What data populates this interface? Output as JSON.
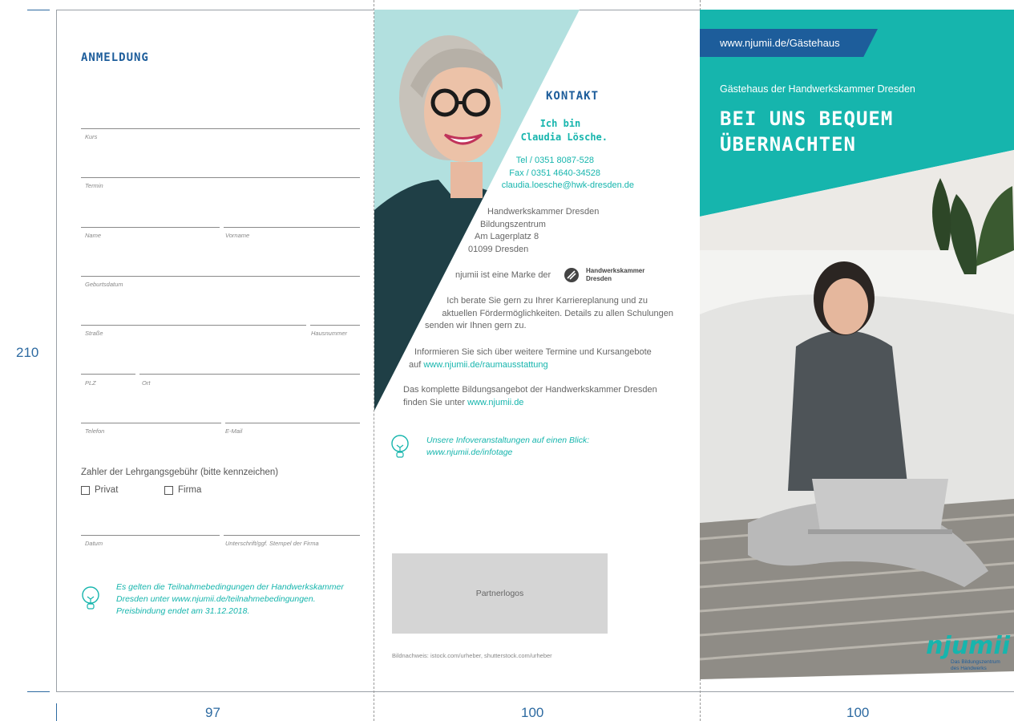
{
  "dimensions": {
    "height_label": "210",
    "panel_widths": [
      "97",
      "100",
      "100"
    ]
  },
  "colors": {
    "teal": "#16b5ad",
    "blue": "#1d5d9b",
    "light_teal": "#b2e0df"
  },
  "left_panel": {
    "title": "ANMELDUNG",
    "fields": {
      "kurs": "Kurs",
      "termin": "Termin",
      "name": "Name",
      "vorname": "Vorname",
      "geburtsdatum": "Geburtsdatum",
      "strasse": "Straße",
      "hausnummer": "Hausnummer",
      "plz": "PLZ",
      "ort": "Ort",
      "telefon": "Telefon",
      "email": "E-Mail",
      "datum": "Datum",
      "unterschrift": "Unterschrift/ggf. Stempel der Firma"
    },
    "payer_label": "Zahler der Lehrgangsgebühr (bitte kennzeichen)",
    "option_private": "Privat",
    "option_company": "Firma",
    "note_lines": [
      "Es gelten die Teilnahmebedingungen der Handwerkskammer",
      "Dresden unter www.njumii.de/teilnahmebedingungen.",
      "Preisbindung endet am 31.12.2018."
    ]
  },
  "middle_panel": {
    "contact_title": "KONTAKT",
    "intro_line1": "Ich bin",
    "intro_line2": "Claudia Lösche.",
    "tel": "Tel / 0351 8087-528",
    "fax": "Fax / 0351 4640-34528",
    "email": "claudia.loesche@hwk-dresden.de",
    "address_lines": [
      "Handwerkskammer Dresden",
      "Bildungszentrum",
      "Am Lagerplatz 8",
      "01099 Dresden"
    ],
    "brand_text": "njumii ist eine Marke der",
    "hwk_line1": "Handwerkskammer",
    "hwk_line2": "Dresden",
    "advice_lines": [
      "Ich berate Sie gern zu Ihrer Karriereplanung und zu",
      "aktuellen Fördermöglichkeiten. Details zu allen Schulungen",
      "senden wir Ihnen gern zu."
    ],
    "info_line1": "Informieren Sie sich über weitere Termine und Kursangebote",
    "info_prefix": "auf ",
    "info_link": "www.njumii.de/raumausstattung",
    "offer_line1": "Das komplette Bildungsangebot der Handwerkskammer Dresden",
    "offer_prefix": "finden Sie unter ",
    "offer_link": "www.njumii.de",
    "infotage_line1": "Unsere Infoveranstaltungen auf einen Blick:",
    "infotage_line2": "www.njumii.de/infotage",
    "partner_logos": "Partnerlogos",
    "credits": "Bildnachweis: istock.com/urheber, shutterstock.com/urheber"
  },
  "right_panel": {
    "url": "www.njumii.de/Gästehaus",
    "subtitle": "Gästehaus der Handwerkskammer Dresden",
    "headline_line1": "BEI UNS BEQUEM",
    "headline_line2": "ÜBERNACHTEN",
    "logo_text": "njumii",
    "logo_tag_line1": "Das Bildungszentrum",
    "logo_tag_line2": "des Handwerks"
  }
}
